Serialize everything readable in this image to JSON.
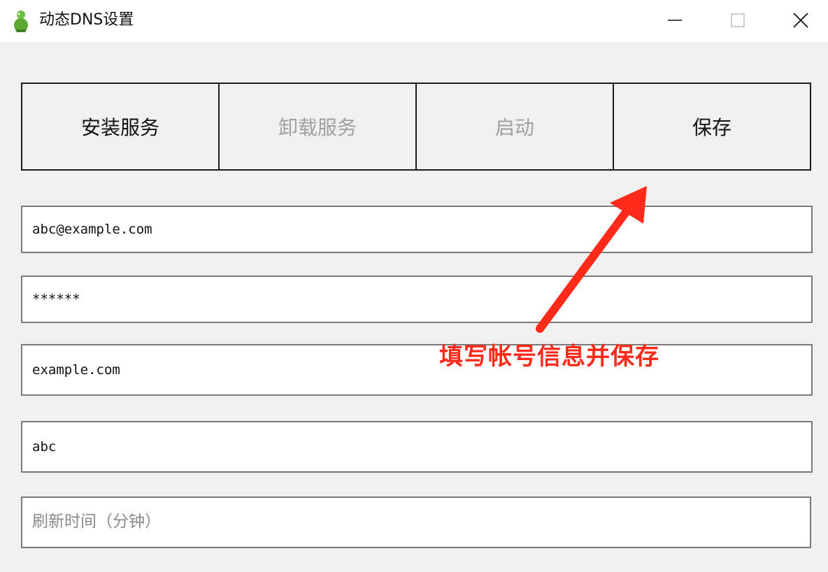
{
  "window": {
    "title": "动态DNS设置",
    "icon": "green-figure-icon",
    "controls": {
      "minimize": "minimize-icon",
      "maximize": "maximize-icon",
      "close": "close-icon"
    }
  },
  "toolbar": {
    "install_label": "安装服务",
    "uninstall_label": "卸载服务",
    "start_label": "启动",
    "save_label": "保存"
  },
  "form": {
    "email_value": "abc@example.com",
    "password_value": "******",
    "domain_value": "example.com",
    "host_value": "abc",
    "refresh_placeholder": "刷新时间（分钟）"
  },
  "annotation": {
    "text": "填写帐号信息并保存",
    "color": "#ff2a1a"
  },
  "colors": {
    "background": "#f0f0f0",
    "disabled_text": "#a0a0a0",
    "border": "#1a1a1a"
  }
}
